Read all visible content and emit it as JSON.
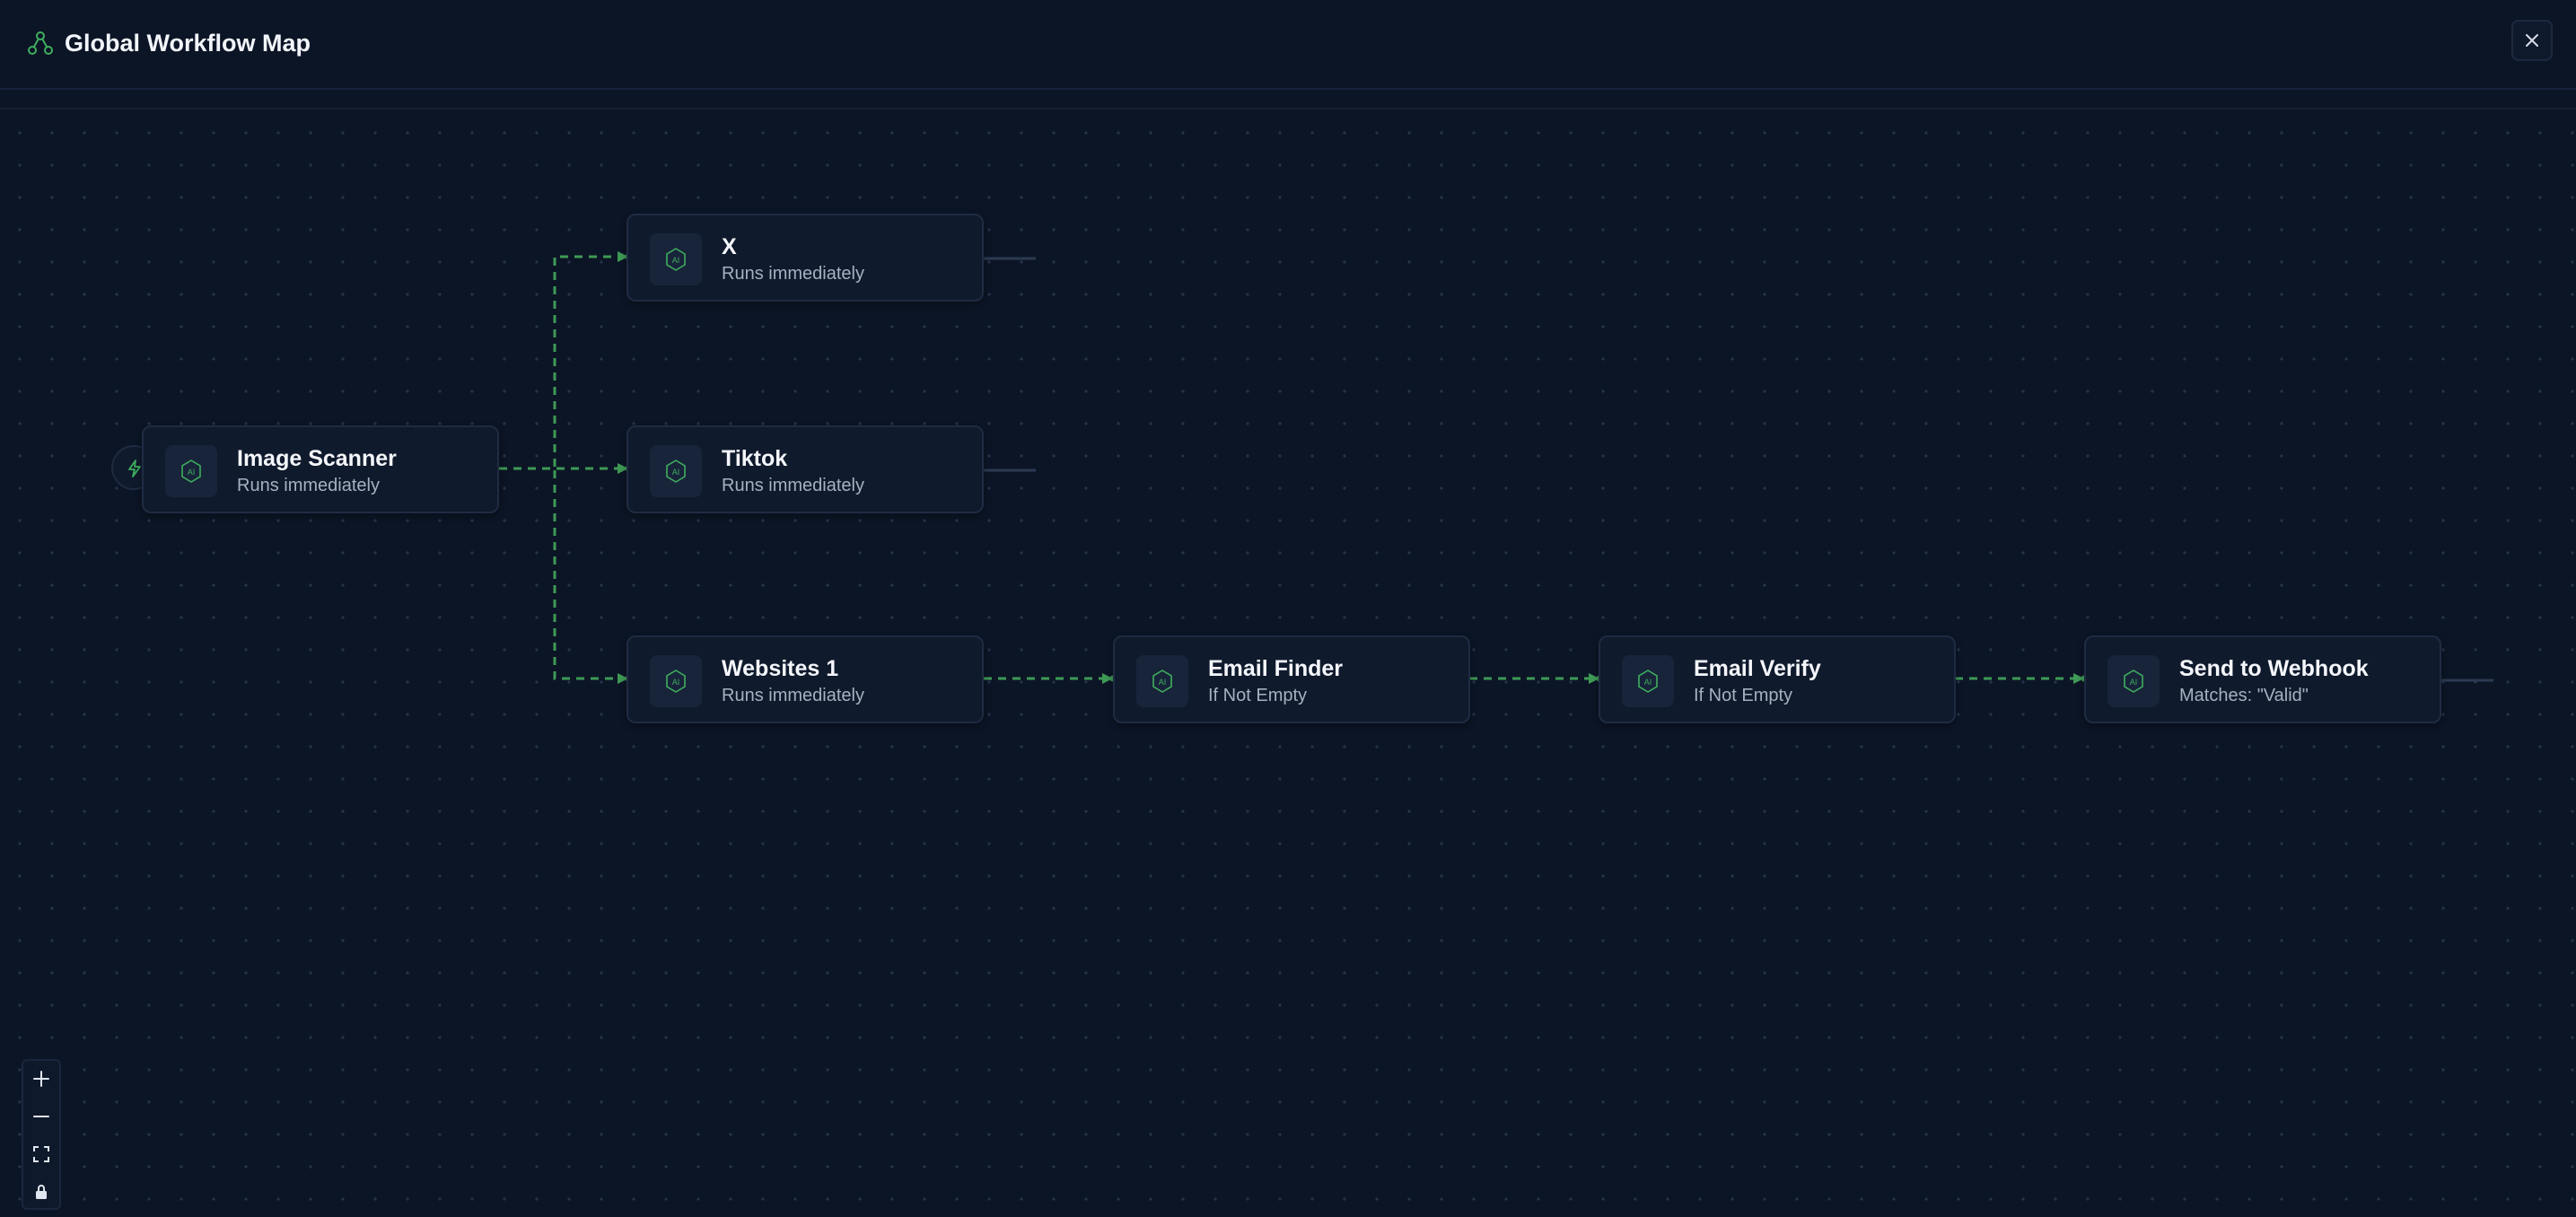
{
  "header": {
    "title": "Global Workflow Map",
    "icon": "workflow-icon",
    "close_icon": "close-icon"
  },
  "trigger": {
    "icon": "lightning-icon"
  },
  "nodes": [
    {
      "id": "image-scanner",
      "title": "Image Scanner",
      "subtitle": "Runs immediately",
      "icon": "ai-chip-icon"
    },
    {
      "id": "x",
      "title": "X",
      "subtitle": "Runs immediately",
      "icon": "ai-chip-icon"
    },
    {
      "id": "tiktok",
      "title": "Tiktok",
      "subtitle": "Runs immediately",
      "icon": "ai-chip-icon"
    },
    {
      "id": "websites-1",
      "title": "Websites 1",
      "subtitle": "Runs immediately",
      "icon": "ai-chip-icon"
    },
    {
      "id": "email-finder",
      "title": "Email Finder",
      "subtitle": "If Not Empty",
      "icon": "ai-chip-icon"
    },
    {
      "id": "email-verify",
      "title": "Email Verify",
      "subtitle": "If Not Empty",
      "icon": "ai-chip-icon"
    },
    {
      "id": "send-to-webhook",
      "title": "Send to Webhook",
      "subtitle": "Matches: \"Valid\"",
      "icon": "ai-chip-icon"
    }
  ],
  "controls": [
    "zoom-in-icon",
    "zoom-out-icon",
    "fit-view-icon",
    "lock-icon"
  ],
  "colors": {
    "background": "#0c1526",
    "node_background": "#0f1a2c",
    "edge": "#3e9a55",
    "accent": "#3fae5e"
  }
}
